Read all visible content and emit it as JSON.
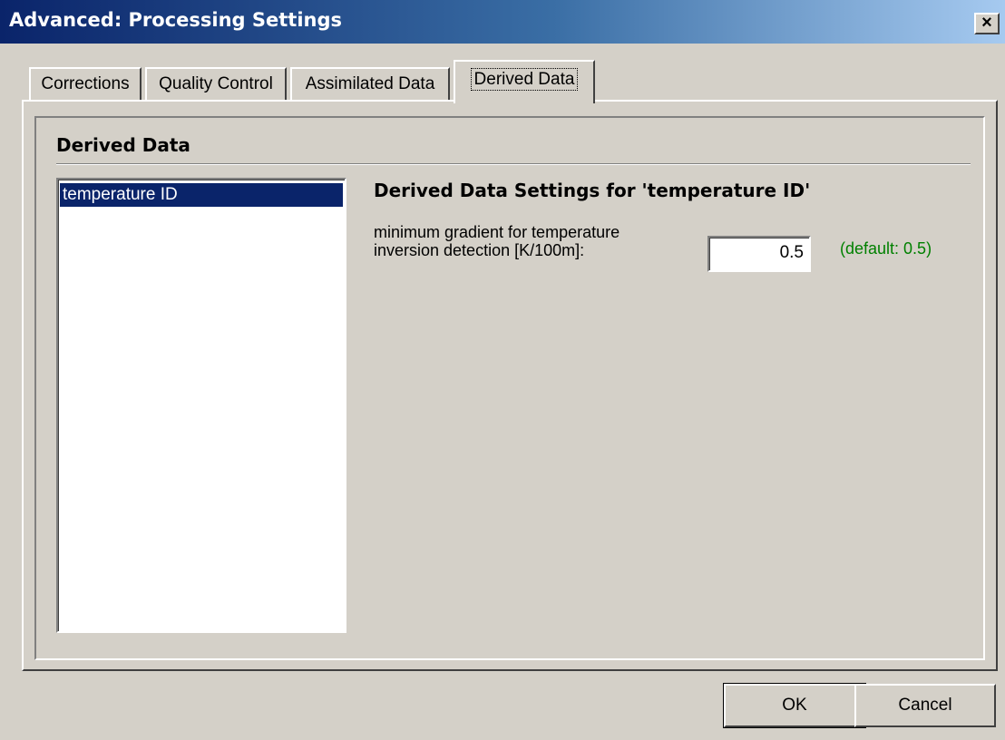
{
  "window": {
    "title": "Advanced: Processing Settings",
    "close_label": "x"
  },
  "tabs": [
    {
      "label": "Corrections",
      "active": false
    },
    {
      "label": "Quality Control",
      "active": false
    },
    {
      "label": "Assimilated Data",
      "active": false
    },
    {
      "label": "Derived Data",
      "active": true
    }
  ],
  "group": {
    "title": "Derived Data"
  },
  "list": {
    "items": [
      {
        "label": "temperature ID",
        "selected": true
      }
    ]
  },
  "settings": {
    "title": "Derived Data Settings for 'temperature ID'",
    "fields": [
      {
        "label": "minimum gradient for temperature inversion detection [K/100m]:",
        "value": "0.5",
        "default": "(default: 0.5)"
      }
    ]
  },
  "buttons": {
    "ok": "OK",
    "cancel": "Cancel"
  },
  "colors": {
    "title_bar": "#0a246a",
    "selection": "#0a246a",
    "default_hint": "#008000",
    "face": "#d4d0c8"
  }
}
